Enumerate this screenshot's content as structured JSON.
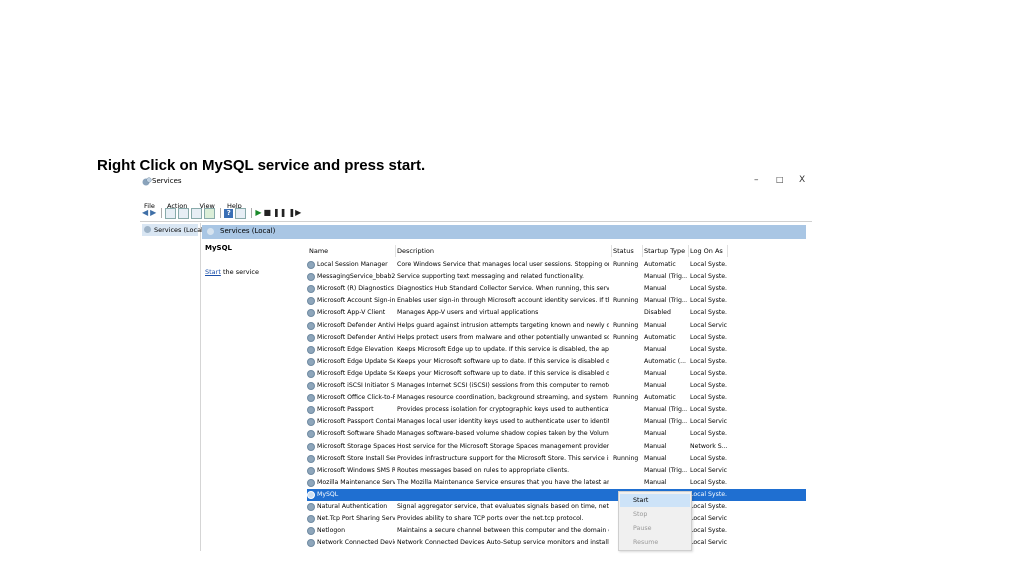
{
  "slide": {
    "instruction": "Right Click on MySQL service and press start."
  },
  "window": {
    "title": "Services",
    "controls": {
      "minimize": "–",
      "maximize": "□",
      "close": "X"
    }
  },
  "menu": [
    "File",
    "Action",
    "View",
    "Help"
  ],
  "toolbar_icons": [
    "back-arrow-icon",
    "forward-arrow-icon",
    "show-hide-tree-icon",
    "refresh-icon",
    "export-icon",
    "properties-icon",
    "help-icon",
    "console-icon",
    "start-service-icon",
    "stop-service-icon",
    "pause-service-icon",
    "resume-service-icon"
  ],
  "tree": {
    "selected": "Services (Local)"
  },
  "pane_header": "Services (Local)",
  "extended": {
    "title": "MySQL",
    "link": "Start",
    "link_suffix": " the service"
  },
  "columns": {
    "name": "Name",
    "description": "Description",
    "status": "Status",
    "startup": "Startup Type",
    "logon": "Log On As"
  },
  "services": [
    {
      "name": "Local Session Manager",
      "description": "Core Windows Service that manages local user sessions. Stopping or disabling t...",
      "status": "Running",
      "startup": "Automatic",
      "logon": "Local Syste..."
    },
    {
      "name": "MessagingService_bbab2",
      "description": "Service supporting text messaging and related functionality.",
      "status": "",
      "startup": "Manual (Trig...",
      "logon": "Local Syste..."
    },
    {
      "name": "Microsoft (R) Diagnostics H...",
      "description": "Diagnostics Hub Standard Collector Service. When running, this service collects...",
      "status": "",
      "startup": "Manual",
      "logon": "Local Syste..."
    },
    {
      "name": "Microsoft Account Sign-in ...",
      "description": "Enables user sign-in through Microsoft account identity services. If this service i...",
      "status": "Running",
      "startup": "Manual (Trig...",
      "logon": "Local Syste..."
    },
    {
      "name": "Microsoft App-V Client",
      "description": "Manages App-V users and virtual applications",
      "status": "",
      "startup": "Disabled",
      "logon": "Local Syste..."
    },
    {
      "name": "Microsoft Defender Antiviru...",
      "description": "Helps guard against intrusion attempts targeting known and newly discovered ...",
      "status": "Running",
      "startup": "Manual",
      "logon": "Local Service"
    },
    {
      "name": "Microsoft Defender Antiviru...",
      "description": "Helps protect users from malware and other potentially unwanted software",
      "status": "Running",
      "startup": "Automatic",
      "logon": "Local Syste..."
    },
    {
      "name": "Microsoft Edge Elevation Se...",
      "description": "Keeps Microsoft Edge up to update. If this service is disabled, the application wi...",
      "status": "",
      "startup": "Manual",
      "logon": "Local Syste..."
    },
    {
      "name": "Microsoft Edge Update Serv...",
      "description": "Keeps your Microsoft software up to date. If this service is disabled or stopped, ...",
      "status": "",
      "startup": "Automatic (...",
      "logon": "Local Syste..."
    },
    {
      "name": "Microsoft Edge Update Serv...",
      "description": "Keeps your Microsoft software up to date. If this service is disabled or stopped, ...",
      "status": "",
      "startup": "Manual",
      "logon": "Local Syste..."
    },
    {
      "name": "Microsoft iSCSI Initiator Ser...",
      "description": "Manages Internet SCSI (iSCSI) sessions from this computer to remote iSCSI targ...",
      "status": "",
      "startup": "Manual",
      "logon": "Local Syste..."
    },
    {
      "name": "Microsoft Office Click-to-R...",
      "description": "Manages resource coordination, background streaming, and system integratio...",
      "status": "Running",
      "startup": "Automatic",
      "logon": "Local Syste..."
    },
    {
      "name": "Microsoft Passport",
      "description": "Provides process isolation for cryptographic keys used to authenticate to a user...",
      "status": "",
      "startup": "Manual (Trig...",
      "logon": "Local Syste..."
    },
    {
      "name": "Microsoft Passport Container",
      "description": "Manages local user identity keys used to authenticate user to identity providers ...",
      "status": "",
      "startup": "Manual (Trig...",
      "logon": "Local Service"
    },
    {
      "name": "Microsoft Software Shadow...",
      "description": "Manages software-based volume shadow copies taken by the Volume Shadow ...",
      "status": "",
      "startup": "Manual",
      "logon": "Local Syste..."
    },
    {
      "name": "Microsoft Storage Spaces S...",
      "description": "Host service for the Microsoft Storage Spaces management provider. If this serv...",
      "status": "",
      "startup": "Manual",
      "logon": "Network S..."
    },
    {
      "name": "Microsoft Store Install Service",
      "description": "Provides infrastructure support for the Microsoft Store.  This service is started o...",
      "status": "Running",
      "startup": "Manual",
      "logon": "Local Syste..."
    },
    {
      "name": "Microsoft Windows SMS Ro...",
      "description": "Routes messages based on rules to appropriate clients.",
      "status": "",
      "startup": "Manual (Trig...",
      "logon": "Local Service"
    },
    {
      "name": "Mozilla Maintenance Service",
      "description": "The Mozilla Maintenance Service ensures that you have the latest and most sec...",
      "status": "",
      "startup": "Manual",
      "logon": "Local Syste..."
    },
    {
      "name": "MySQL",
      "description": "",
      "status": "",
      "startup": "",
      "logon": "Local Syste..."
    },
    {
      "name": "Natural Authentication",
      "description": "Signal aggregator service, that evaluates signals based on time, network, geolo...",
      "status": "",
      "startup": "",
      "logon": "Local Syste..."
    },
    {
      "name": "Net.Tcp Port Sharing Service",
      "description": "Provides ability to share TCP ports over the net.tcp protocol.",
      "status": "",
      "startup": "",
      "logon": "Local Service"
    },
    {
      "name": "Netlogon",
      "description": "Maintains a secure channel between this computer and the domain controller f...",
      "status": "",
      "startup": "",
      "logon": "Local Syste..."
    },
    {
      "name": "Network Connected Device...",
      "description": "Network Connected Devices Auto-Setup service monitors and installs qualified ...",
      "status": "",
      "startup": "",
      "logon": "Local Service"
    }
  ],
  "selected_service": "MySQL",
  "context_menu": {
    "items": [
      {
        "label": "Start",
        "state": "highlighted"
      },
      {
        "label": "Stop",
        "state": "disabled"
      },
      {
        "label": "Pause",
        "state": "disabled"
      },
      {
        "label": "Resume",
        "state": "disabled"
      }
    ]
  }
}
